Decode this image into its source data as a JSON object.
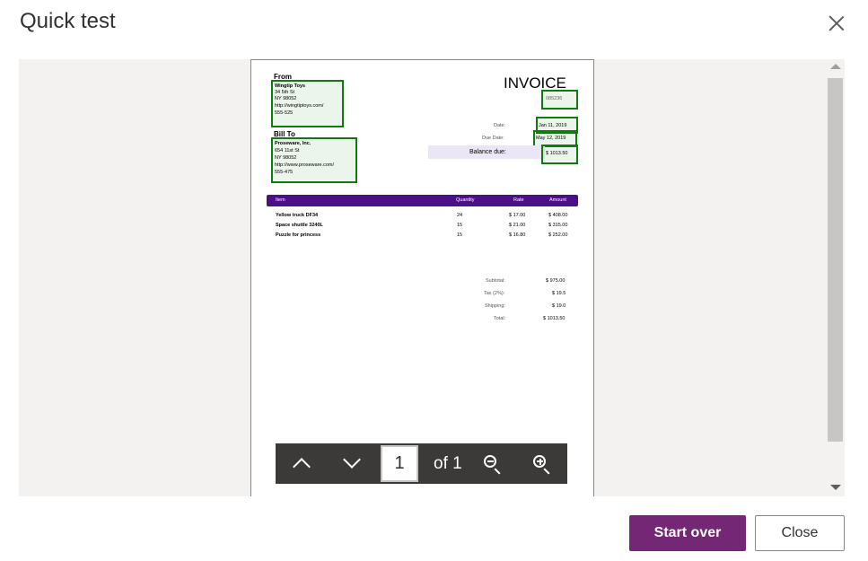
{
  "dialog": {
    "title": "Quick test"
  },
  "invoice": {
    "from_label": "From",
    "from_lines": [
      "Wingtip Toys",
      "34 5th St",
      "NY 98052",
      "http://wingtiptoys.com/",
      "555-525"
    ],
    "bill_to_label": "Bill To",
    "bill_to_lines": [
      "Proseware, Inc.",
      "654 11st St",
      "NY 98052",
      "http://www.proseware.com/",
      "555-475"
    ],
    "title": "INVOICE",
    "number": "085236",
    "date_label": "Date:",
    "date_value": "Jan 11, 2019",
    "due_label": "Due Date:",
    "due_value": "May 12, 2019",
    "balance_label": "Balance due:",
    "balance_value": "$ 1013.50",
    "columns": [
      "Item",
      "Quantity",
      "Rate",
      "Amount"
    ],
    "items": [
      {
        "name": "Yellow truck DF34",
        "qty": "24",
        "rate": "$ 17.00",
        "amount": "$ 408.00"
      },
      {
        "name": "Space shuttle 3240L",
        "qty": "15",
        "rate": "$ 21.00",
        "amount": "$ 315.00"
      },
      {
        "name": "Puzzle for princess",
        "qty": "15",
        "rate": "$ 16.80",
        "amount": "$ 252.00"
      }
    ],
    "totals": [
      {
        "label": "Subtotal:",
        "value": "$ 975.00"
      },
      {
        "label": "Tax (2%):",
        "value": "$ 19.5"
      },
      {
        "label": "Shipping:",
        "value": "$ 19.0"
      },
      {
        "label": "Total:",
        "value": "$ 1013.50"
      }
    ],
    "highlight_color": "#107c10",
    "header_color": "#4b0f8a"
  },
  "pager": {
    "current_page": "1",
    "of_label": "of 1"
  },
  "footer": {
    "start_over_label": "Start over",
    "close_label": "Close"
  },
  "colors": {
    "primary": "#742774"
  }
}
